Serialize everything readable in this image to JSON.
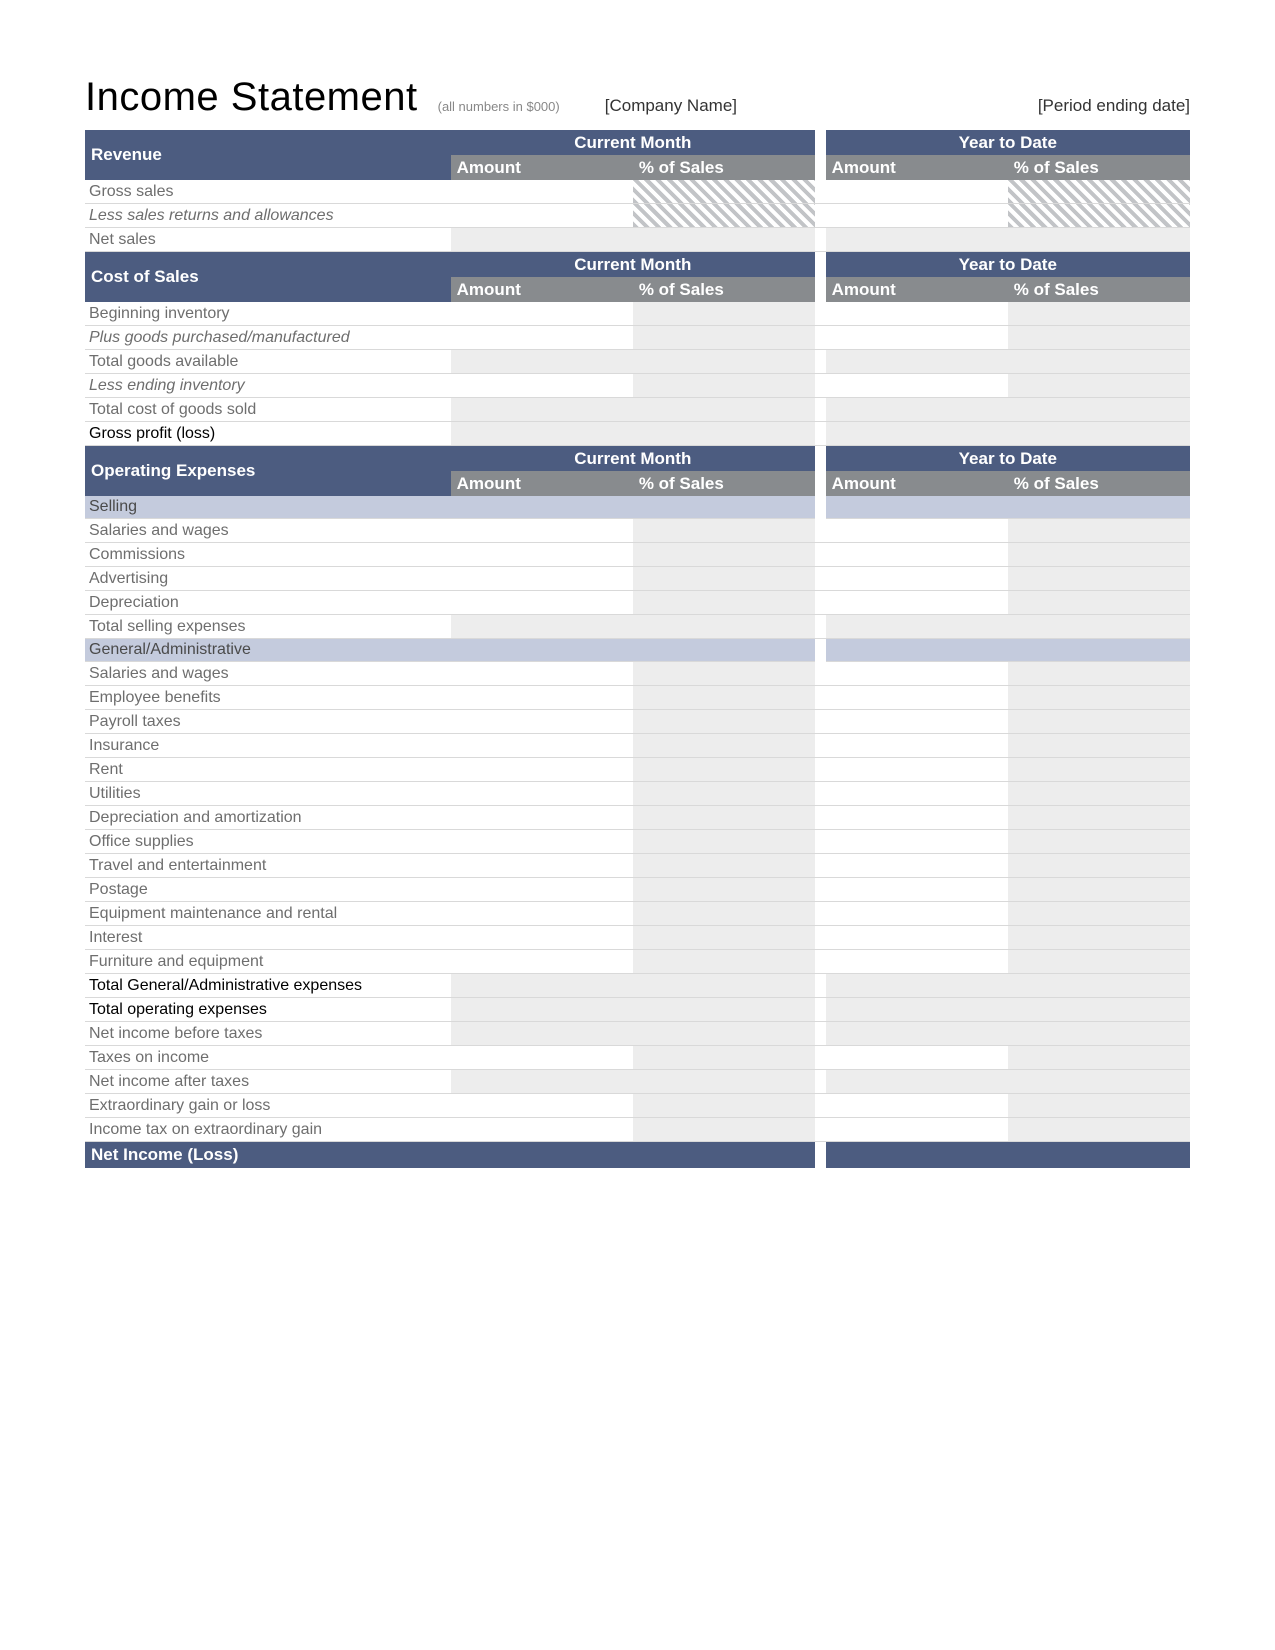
{
  "header": {
    "title": "Income Statement",
    "note": "(all numbers in $000)",
    "company_placeholder": "[Company Name]",
    "period_placeholder": "[Period ending date]"
  },
  "period_labels": {
    "current": "Current Month",
    "ytd": "Year to Date",
    "amount": "Amount",
    "pct": "% of Sales"
  },
  "sections": {
    "revenue": {
      "title": "Revenue",
      "rows": [
        {
          "label": "Gross sales",
          "style": "",
          "hatched_pct": true,
          "shaded": false
        },
        {
          "label": "Less sales returns and allowances",
          "style": "italic",
          "hatched_pct": true,
          "shaded": false
        },
        {
          "label": "Net sales",
          "style": "",
          "hatched_pct": false,
          "shaded": true
        }
      ]
    },
    "cost_of_sales": {
      "title": "Cost of Sales",
      "rows": [
        {
          "label": "Beginning inventory",
          "style": "",
          "shaded": false
        },
        {
          "label": "Plus goods purchased/manufactured",
          "style": "italic",
          "shaded": false
        },
        {
          "label": "Total goods available",
          "style": "",
          "shaded": true
        },
        {
          "label": "Less ending inventory",
          "style": "italic",
          "shaded": false
        },
        {
          "label": "Total cost of goods sold",
          "style": "",
          "shaded": true
        },
        {
          "label": "Gross profit (loss)",
          "style": "black",
          "shaded": true
        }
      ]
    },
    "opex": {
      "title": "Operating Expenses",
      "selling": {
        "subtitle": "Selling",
        "rows": [
          {
            "label": "Salaries and wages"
          },
          {
            "label": "Commissions"
          },
          {
            "label": "Advertising"
          },
          {
            "label": "Depreciation"
          },
          {
            "label": "Total selling expenses",
            "shaded": true
          }
        ]
      },
      "ga": {
        "subtitle": "General/Administrative",
        "rows": [
          {
            "label": "Salaries and wages"
          },
          {
            "label": "Employee benefits"
          },
          {
            "label": "Payroll taxes"
          },
          {
            "label": "Insurance"
          },
          {
            "label": "Rent"
          },
          {
            "label": "Utilities"
          },
          {
            "label": "Depreciation and amortization"
          },
          {
            "label": "Office supplies"
          },
          {
            "label": "Travel and entertainment"
          },
          {
            "label": "Postage"
          },
          {
            "label": "Equipment maintenance and rental"
          },
          {
            "label": "Interest"
          },
          {
            "label": "Furniture and equipment"
          }
        ]
      },
      "totals": [
        {
          "label": "Total General/Administrative expenses"
        },
        {
          "label": "Total operating expenses"
        }
      ],
      "tail": [
        {
          "label": "Net income before taxes",
          "shaded": true
        },
        {
          "label": "Taxes on income",
          "shaded": false
        },
        {
          "label": "Net income after taxes",
          "shaded": true
        },
        {
          "label": "Extraordinary gain or loss",
          "shaded": false
        },
        {
          "label": "Income tax on extraordinary gain",
          "shaded": false
        }
      ],
      "final": {
        "label": "Net Income (Loss)"
      }
    }
  }
}
